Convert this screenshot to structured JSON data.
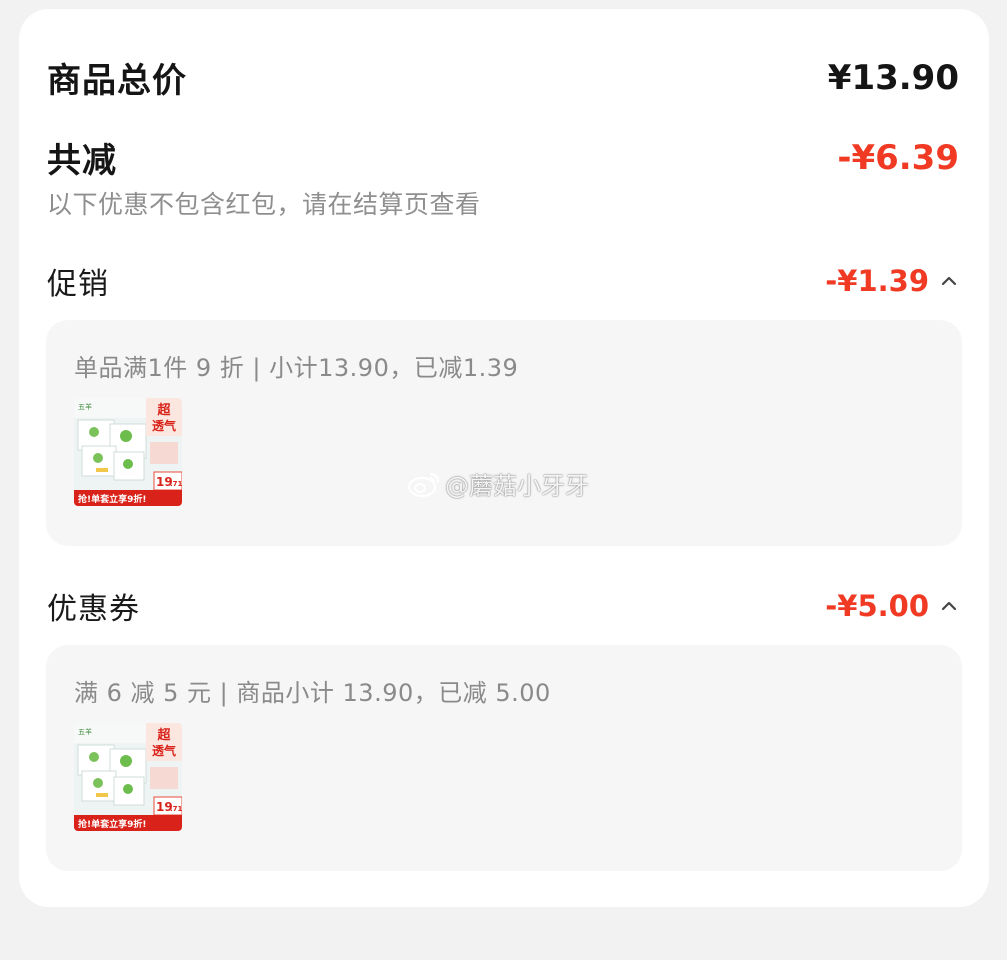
{
  "summary": {
    "total_label": "商品总价",
    "total_value": "¥13.90",
    "reduce_label": "共减",
    "reduce_value": "-¥6.39",
    "note": "以下优惠不包含红包，请在结算页查看"
  },
  "sections": [
    {
      "title": "促销",
      "amount": "-¥1.39",
      "desc": "单品满1件 9 折 | 小计13.90，已减1.39",
      "product": {
        "brand": "五羊",
        "badge_line1": "超",
        "badge_line2": "透气",
        "price_int": "19",
        "price_dec": ".71",
        "banner": "抢!单套立享9折!"
      }
    },
    {
      "title": "优惠券",
      "amount": "-¥5.00",
      "desc": "满 6 减 5 元 | 商品小计 13.90，已减 5.00",
      "product": {
        "brand": "五羊",
        "badge_line1": "超",
        "badge_line2": "透气",
        "price_int": "19",
        "price_dec": ".71",
        "banner": "抢!单套立享9折!"
      }
    }
  ],
  "watermark": "@蘑菇小牙牙",
  "colors": {
    "accent_red": "#f03a23",
    "text_dark": "#151515",
    "text_gray": "#8a8a8a",
    "box_bg": "#f6f6f6"
  }
}
